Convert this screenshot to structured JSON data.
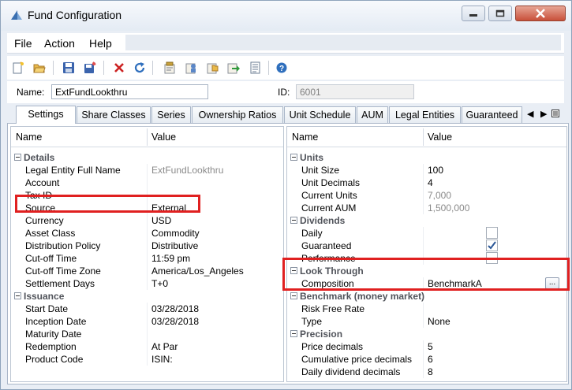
{
  "window": {
    "title": "Fund Configuration"
  },
  "menu": {
    "items": [
      "File",
      "Action",
      "Help"
    ]
  },
  "toolbar": {
    "icons": [
      "new-icon",
      "open-icon",
      "save-icon",
      "save-all-icon",
      "delete-icon",
      "refresh-icon",
      "properties-icon",
      "user-icon",
      "folder-icon",
      "export-icon",
      "report-icon",
      "help-icon"
    ]
  },
  "fields": {
    "name_label": "Name:",
    "name_value": "ExtFundLookthru",
    "id_label": "ID:",
    "id_value": "6001"
  },
  "tabs": [
    "Settings",
    "Share Classes",
    "Series",
    "Ownership Ratios",
    "Unit Schedule",
    "AUM",
    "Legal Entities",
    "Guaranteed"
  ],
  "tab_scroll": {
    "left": "◀",
    "right": "▶"
  },
  "left_grid": {
    "col_name": "Name",
    "col_value": "Value",
    "categories": [
      {
        "title": "Details",
        "rows": [
          {
            "k": "Legal Entity Full Name",
            "v": "ExtFundLookthru",
            "grey": true
          },
          {
            "k": "Account",
            "v": ""
          },
          {
            "k": "Tax ID",
            "v": ""
          },
          {
            "k": "Source",
            "v": "External"
          },
          {
            "k": "Currency",
            "v": "USD"
          },
          {
            "k": "Asset Class",
            "v": "Commodity"
          },
          {
            "k": "Distribution Policy",
            "v": "Distributive"
          },
          {
            "k": "Cut-off Time",
            "v": "11:59 pm"
          },
          {
            "k": "Cut-off Time Zone",
            "v": "America/Los_Angeles"
          },
          {
            "k": "Settlement Days",
            "v": "T+0"
          }
        ]
      },
      {
        "title": "Issuance",
        "rows": [
          {
            "k": "Start Date",
            "v": "03/28/2018"
          },
          {
            "k": "Inception Date",
            "v": "03/28/2018"
          },
          {
            "k": "Maturity Date",
            "v": ""
          },
          {
            "k": "Redemption",
            "v": "At Par"
          },
          {
            "k": "Product Code",
            "v": "ISIN:"
          }
        ]
      }
    ]
  },
  "right_grid": {
    "col_name": "Name",
    "col_value": "Value",
    "categories": [
      {
        "title": "Units",
        "rows": [
          {
            "k": "Unit Size",
            "v": "100"
          },
          {
            "k": "Unit Decimals",
            "v": "4"
          },
          {
            "k": "Current Units",
            "v": "7,000",
            "grey": true
          },
          {
            "k": "Current AUM",
            "v": "1,500,000",
            "grey": true
          }
        ]
      },
      {
        "title": "Dividends",
        "rows": [
          {
            "k": "Daily",
            "checkbox": true,
            "checked": false
          },
          {
            "k": "Guaranteed",
            "checkbox": true,
            "checked": true
          },
          {
            "k": "Performance",
            "checkbox": true,
            "checked": false
          }
        ]
      },
      {
        "title": "Look Through",
        "rows": [
          {
            "k": "Composition",
            "v": "BenchmarkA",
            "ellipsis": "..."
          }
        ]
      },
      {
        "title": "Benchmark (money market)",
        "rows": [
          {
            "k": "Risk Free Rate",
            "v": ""
          },
          {
            "k": "Type",
            "v": "None"
          }
        ]
      },
      {
        "title": "Precision",
        "rows": [
          {
            "k": "Price decimals",
            "v": "5"
          },
          {
            "k": "Cumulative price decimals",
            "v": "6"
          },
          {
            "k": "Daily dividend decimals",
            "v": "8"
          }
        ]
      }
    ]
  },
  "colors": {
    "highlight": "#e02020",
    "window_bg": "#e9eef5",
    "check": "#2b5797"
  }
}
